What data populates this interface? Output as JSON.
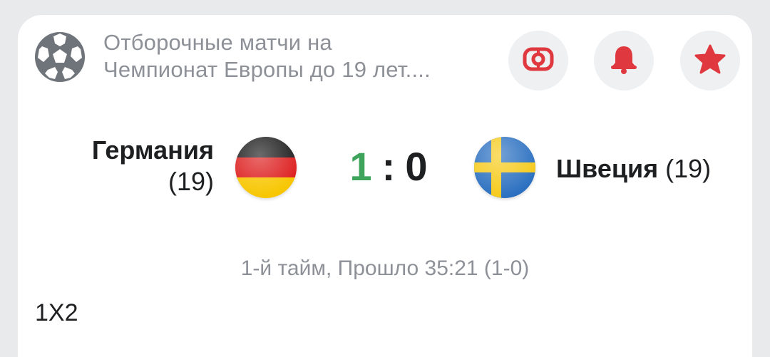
{
  "league": {
    "icon": "football-icon",
    "title_line1": "Отборочные матчи на",
    "title_line2": "Чемпионат Европы до 19 лет...."
  },
  "actions": {
    "tv_icon": "live-stream-icon",
    "bell_icon": "bell-icon",
    "star_icon": "star-icon",
    "accent_color": "#e0383f"
  },
  "match": {
    "home": {
      "name": "Германия",
      "suffix": "(19)",
      "flag": "germany-flag-icon"
    },
    "away": {
      "name": "Швеция",
      "suffix": "(19)",
      "flag": "sweden-flag-icon"
    },
    "score_home": "1",
    "score_sep": ":",
    "score_away": "0",
    "leading_color": "#3fa45b",
    "status": "1-й тайм, Прошло 35:21 (1-0)"
  },
  "market": {
    "label": "1X2"
  }
}
